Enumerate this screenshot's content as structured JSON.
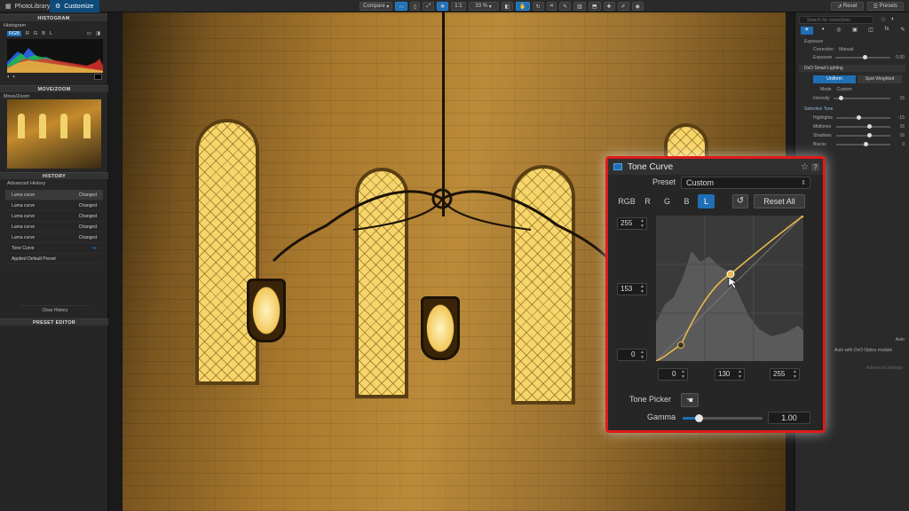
{
  "topbar": {
    "tab_library": "PhotoLibrary",
    "tab_customize": "Customize",
    "compare_label": "Compare",
    "zoom_fit": "1:1",
    "zoom_level": "33 %",
    "reset_label": "Reset",
    "presets_label": "Presets"
  },
  "left": {
    "histogram_header": "HISTOGRAM",
    "histogram_label": "Histogram",
    "channels": [
      "RGB",
      "R",
      "G",
      "B",
      "L"
    ],
    "movezoom_header": "MOVE/ZOOM",
    "movezoom_label": "Move/Zoom",
    "history_header": "HISTORY",
    "history_label": "Advanced History",
    "history_items": [
      {
        "name": "Luma curve",
        "state": "Changed"
      },
      {
        "name": "Luma curve",
        "state": "Changed"
      },
      {
        "name": "Luma curve",
        "state": "Changed"
      },
      {
        "name": "Luma curve",
        "state": "Changed"
      },
      {
        "name": "Luma curve",
        "state": "Changed"
      },
      {
        "name": "Tone Curve",
        "state": ""
      },
      {
        "name": "Applied Default Preset",
        "state": ""
      }
    ],
    "clear_history": "Clear History",
    "preset_editor_header": "PRESET EDITOR"
  },
  "right": {
    "search_placeholder": "Search for corrections",
    "exposure_label": "Exposure",
    "correction_label": "Correction",
    "correction_value": "Manual",
    "exposure_row_label": "Exposure",
    "exposure_value": "0.00",
    "smart_lighting": "DxO Smart Lighting",
    "uniform_label": "Uniform",
    "spot_weighted_label": "Spot Weighted",
    "mode_label": "Mode",
    "mode_value": "Custom",
    "intensity_label": "Intensity",
    "intensity_value": "15",
    "selective_tone": "Selective Tone",
    "highlights_label": "Highlights",
    "highlights_value": "-15",
    "midtones_label": "Midtones",
    "midtones_value": "16",
    "shadows_label": "Shadows",
    "shadows_value": "16",
    "blacks_label": "Blacks",
    "blacks_value": "0",
    "auto_label": "Auto",
    "optics_label": "Auto with DxO Optics module",
    "advanced_label": "Advanced settings"
  },
  "tonecurve": {
    "title": "Tone Curve",
    "preset_label": "Preset",
    "preset_value": "Custom",
    "channels": [
      "RGB",
      "R",
      "G",
      "B",
      "L"
    ],
    "active_channel": "L",
    "reset_all": "Reset All",
    "out_high": "255",
    "out_mid": "153",
    "out_low": "0",
    "in_low": "0",
    "in_mid": "130",
    "in_high": "255",
    "tone_picker_label": "Tone Picker",
    "gamma_label": "Gamma",
    "gamma_value": "1.00",
    "accent_color": "#1f6fb5",
    "curve_color": "#e8b84a",
    "highlight_border": "#e01a1a"
  }
}
